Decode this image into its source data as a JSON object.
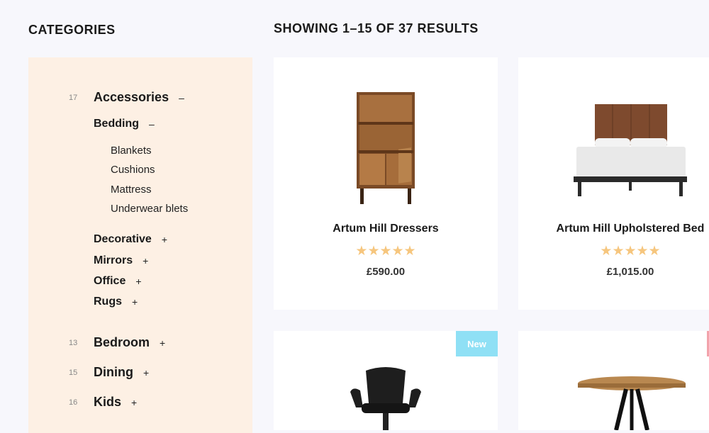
{
  "sidebar": {
    "title": "CATEGORIES",
    "categories": [
      {
        "count": "17",
        "name": "Accessories",
        "toggle": "–",
        "subcategories": [
          {
            "name": "Bedding",
            "toggle": "–",
            "items": [
              "Blankets",
              "Cushions",
              "Mattress",
              "Underwear blets"
            ]
          },
          {
            "name": "Decorative",
            "toggle": "+"
          },
          {
            "name": "Mirrors",
            "toggle": "+"
          },
          {
            "name": "Office",
            "toggle": "+"
          },
          {
            "name": "Rugs",
            "toggle": "+"
          }
        ]
      },
      {
        "count": "13",
        "name": "Bedroom",
        "toggle": "+"
      },
      {
        "count": "15",
        "name": "Dining",
        "toggle": "+"
      },
      {
        "count": "16",
        "name": "Kids",
        "toggle": "+"
      }
    ]
  },
  "results": {
    "title": "SHOWING 1–15 OF 37 RESULTS"
  },
  "products": [
    {
      "name": "Artum Hill Dressers",
      "rating": 5,
      "price": "£590.00",
      "stars": "★★★★★",
      "image_icon": "bookcase-cabinet-icon"
    },
    {
      "name": "Artum Hill Upholstered Bed",
      "rating": 5,
      "price": "£1,015.00",
      "stars": "★★★★★",
      "image_icon": "bed-icon"
    },
    {
      "badge": "New",
      "image_icon": "chair-icon"
    },
    {
      "badge_color": "#f2a3ab",
      "image_icon": "round-table-icon"
    }
  ],
  "colors": {
    "page_bg": "#f7f7fc",
    "sidebar_bg": "#fdf0e4",
    "star": "#f6c67e",
    "badge_new": "#8fe0f5"
  }
}
